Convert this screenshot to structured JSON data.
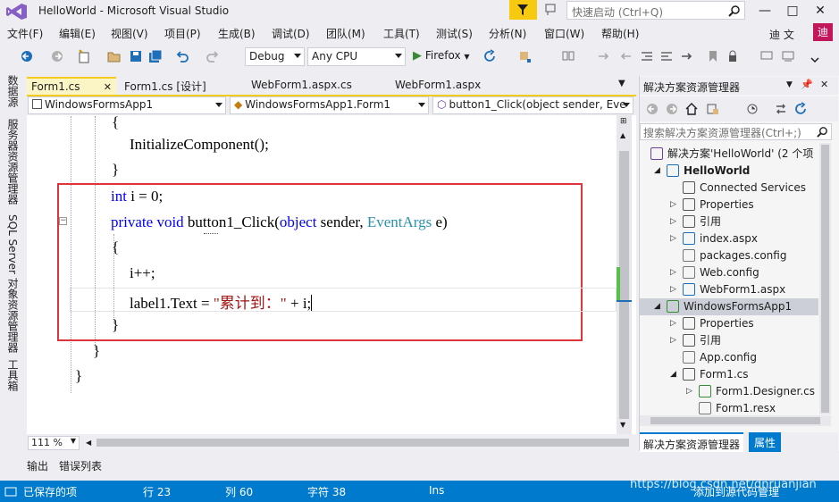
{
  "title_bar": {
    "title": "HelloWorld - Microsoft Visual Studio",
    "quick_launch_placeholder": "快速启动 (Ctrl+Q)",
    "minimize": "—",
    "restore": "□",
    "close": "✕"
  },
  "menu": {
    "items": [
      "文件(F)",
      "编辑(E)",
      "视图(V)",
      "项目(P)",
      "生成(B)",
      "调试(D)",
      "团队(M)",
      "工具(T)",
      "测试(S)",
      "分析(N)",
      "窗口(W)",
      "帮助(H)"
    ],
    "account_name": "迪 文",
    "avatar_letter": "迪"
  },
  "toolbar": {
    "config": "Debug",
    "platform": "Any CPU",
    "run_label": "Firefox"
  },
  "left_bar": {
    "tabs": [
      "数据源",
      "服务器资源管理器",
      "SQL Server 对象资源管理器",
      "工具箱"
    ]
  },
  "doc_tabs": {
    "tabs": [
      "Form1.cs",
      "Form1.cs [设计]",
      "WebForm1.aspx.cs",
      "WebForm1.aspx"
    ],
    "close_glyph": "✕"
  },
  "nav_bar": {
    "project": "WindowsFormsApp1",
    "class": "WindowsFormsApp1.Form1",
    "member": "button1_Click(object sender, Eve"
  },
  "code": {
    "brace_open_1": "{",
    "init_call": "InitializeComponent();",
    "brace_close_1": "}",
    "decl_kw": "int",
    "decl_rest": " i = 0;",
    "method_kw": "private void",
    "method_name": " button1_Click(",
    "param_kw": "object",
    "param_sender": " sender, ",
    "param_type": "EventArgs",
    "param_e": " e)",
    "brace_open_2": "{",
    "increment": "i++;",
    "assign_left": "label1.Text = ",
    "assign_string": "\"累计到：\"",
    "assign_right": " + i;",
    "brace_close_2": "}",
    "brace_close_3": "}",
    "brace_close_4": "}"
  },
  "editor": {
    "zoom": "111 %"
  },
  "solution_explorer": {
    "title": "解决方案资源管理器",
    "search_placeholder": "搜索解决方案资源管理器(Ctrl+;)",
    "tree": [
      {
        "label": "解决方案'HelloWorld' (2 个项",
        "level": 0,
        "expander": "",
        "icon": "solution-icon"
      },
      {
        "label": "HelloWorld",
        "level": 1,
        "expander": "◢",
        "icon": "web-project-icon",
        "bold": true
      },
      {
        "label": "Connected Services",
        "level": 2,
        "expander": "",
        "icon": "connected-services-icon"
      },
      {
        "label": "Properties",
        "level": 2,
        "expander": "▷",
        "icon": "wrench-icon"
      },
      {
        "label": "引用",
        "level": 2,
        "expander": "▷",
        "icon": "references-icon"
      },
      {
        "label": "index.aspx",
        "level": 2,
        "expander": "▷",
        "icon": "web-file-icon"
      },
      {
        "label": "packages.config",
        "level": 2,
        "expander": "",
        "icon": "config-file-icon"
      },
      {
        "label": "Web.config",
        "level": 2,
        "expander": "▷",
        "icon": "config-file-icon"
      },
      {
        "label": "WebForm1.aspx",
        "level": 2,
        "expander": "▷",
        "icon": "web-file-icon"
      },
      {
        "label": "WindowsFormsApp1",
        "level": 1,
        "expander": "◢",
        "icon": "csharp-project-icon",
        "selected": true
      },
      {
        "label": "Properties",
        "level": 2,
        "expander": "▷",
        "icon": "wrench-icon"
      },
      {
        "label": "引用",
        "level": 2,
        "expander": "▷",
        "icon": "references-icon"
      },
      {
        "label": "App.config",
        "level": 2,
        "expander": "",
        "icon": "config-file-icon"
      },
      {
        "label": "Form1.cs",
        "level": 2,
        "expander": "◢",
        "icon": "form-icon"
      },
      {
        "label": "Form1.Designer.cs",
        "level": 3,
        "expander": "▷",
        "icon": "csharp-file-icon"
      },
      {
        "label": "Form1.resx",
        "level": 3,
        "expander": "",
        "icon": "resource-file-icon"
      }
    ],
    "bottom_tabs": [
      "解决方案资源管理器",
      "属性"
    ]
  },
  "output_tabs": [
    "输出",
    "错误列表"
  ],
  "status_bar": {
    "saved": "已保存的项",
    "line": "行 23",
    "col": "列 60",
    "char": "字符 38",
    "mode": "Ins",
    "source_control": "添加到源代码管理",
    "watermark": "https://blog.csdn.net/dnruanjian"
  },
  "colors": {
    "accent": "#007acc",
    "highlight_box": "#e0343c",
    "active_tab": "#fbf4c4",
    "keyword": "#0000ff",
    "type": "#2b91af",
    "string": "#a31515"
  }
}
